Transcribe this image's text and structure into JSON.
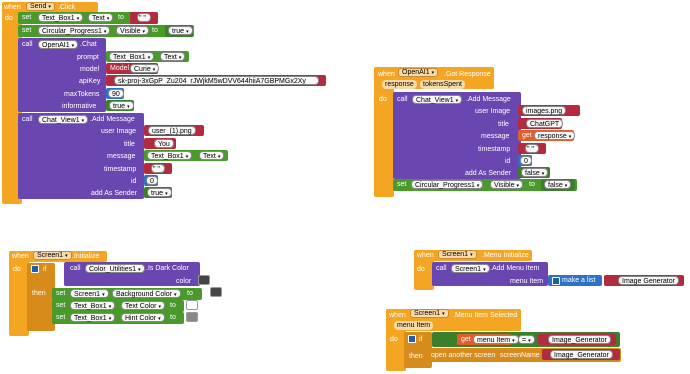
{
  "b1": {
    "when": "when",
    "comp": "Send",
    "ev": ".Click",
    "do": "do",
    "set1": "set",
    "comp1": "Text_Box1",
    "prop1": "Text",
    "to1": "to",
    "val1": "\" \"",
    "set2": "set",
    "comp2": "Circular_Progress1",
    "prop2": "Visible",
    "to2": "to",
    "val2": "true",
    "call": "call",
    "comp3": "OpenAI1",
    "method": ".Chat",
    "prompt": "prompt",
    "prompt_comp": "Text_Box1",
    "prompt_prop": "Text",
    "model": "model",
    "model_val": "Model",
    "model_opt": "Curie",
    "apikey": "apiKey",
    "apikey_val": "sk-proj-3xGpP_Zu204_rJWjkM5wDVV644hiiA7GBPMGx2Xy",
    "maxtokens": "maxTokens",
    "maxtokens_val": "90",
    "informative": "informative",
    "informative_val": "true",
    "call2": "call",
    "comp4": "Chat_View1",
    "method2": ".Add Message",
    "userimage": "user Image",
    "userimage_val": "user_(1).png",
    "title": "title",
    "title_val": "You",
    "message": "message",
    "message_comp": "Text_Box1",
    "message_prop": "Text",
    "timestamp": "timestamp",
    "timestamp_val": "\" \"",
    "id": "id",
    "id_val": "0",
    "addsender": "add As Sender",
    "addsender_val": "true"
  },
  "b2": {
    "when": "when",
    "comp": "OpenAI1",
    "ev": ".Got Response",
    "p1": "response",
    "p2": "tokensSpent",
    "do": "do",
    "call": "call",
    "comp2": "Chat_View1",
    "method": ".Add Message",
    "userimage": "user Image",
    "userimage_val": "images.png",
    "title": "title",
    "title_val": "ChatGPT",
    "message": "message",
    "get": "get",
    "get_val": "response",
    "timestamp": "timestamp",
    "timestamp_val": "\" \"",
    "id": "id",
    "id_val": "0",
    "addsender": "add As Sender",
    "addsender_val": "false",
    "set": "set",
    "comp3": "Circular_Progress1",
    "prop": "Visible",
    "to": "to",
    "val": "false"
  },
  "b3": {
    "when": "when",
    "comp": "Screen1",
    "ev": ".Initialize",
    "do": "do",
    "if": "if",
    "call": "call",
    "comp2": "Color_Utilities1",
    "method": ".Is Dark Color",
    "color": "color",
    "then": "then",
    "set1": "set",
    "comp3": "Screen1",
    "prop1": "Background Color",
    "to1": "to",
    "set2": "set",
    "comp4": "Text_Box1",
    "prop2": "Text Color",
    "to2": "to",
    "set3": "set",
    "comp5": "Text_Box1",
    "prop3": "Hint Color",
    "to3": "to"
  },
  "b4": {
    "when": "when",
    "comp": "Screen1",
    "ev": ".Menu Initialize",
    "do": "do",
    "call": "call",
    "comp2": "Screen1",
    "method": ".Add Menu Item",
    "menuitem": "menu Item",
    "makelist": "make a list",
    "listval": "Image Generator"
  },
  "b5": {
    "when": "when",
    "comp": "Screen1",
    "ev": ".Menu Item Selected",
    "p1": "menu Item",
    "do": "do",
    "if": "if",
    "get": "get",
    "get_val": "menu Item",
    "op": "=",
    "cmp": "Image_Generator",
    "then": "then",
    "open": "open another screen",
    "screenname": "screenName",
    "screen_val": "Image_Generator"
  },
  "colors": {
    "event": "#f4a623",
    "call": "#6a46b0",
    "setter": "#4a9a2b",
    "text": "#b22b3f",
    "list": "#2e72c6",
    "control": "#d78b1a"
  }
}
